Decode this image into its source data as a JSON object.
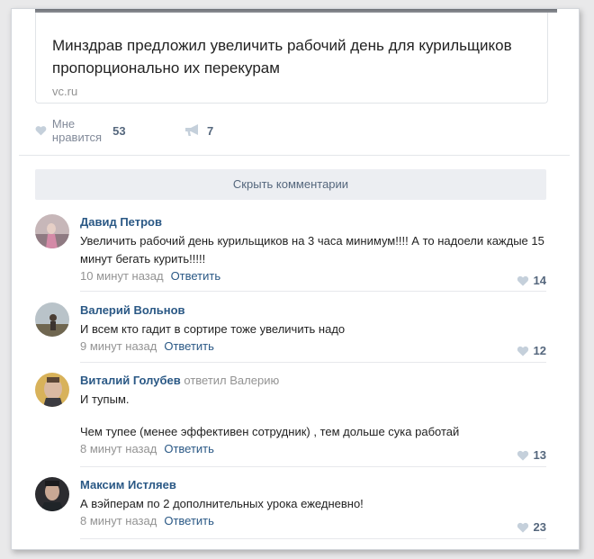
{
  "post": {
    "link_title": "Минздрав предложил увеличить рабочий день для курильщиков пропорционально их перекурам",
    "link_domain": "vc.ru",
    "like_label": "Мне нравится",
    "like_count": "53",
    "share_count": "7"
  },
  "hide_comments_label": "Скрыть комментарии",
  "comments": [
    {
      "author": "Давид Петров",
      "text": "Увеличить рабочий день курильщиков на 3 часа минимум!!!! А то надоели каждые 15 минут бегать курить!!!!!",
      "time": "10 минут назад",
      "reply_label": "Ответить",
      "likes": "14"
    },
    {
      "author": "Валерий Вольнов",
      "text": "И всем кто гадит в сортире тоже увеличить надо",
      "time": "9 минут назад",
      "reply_label": "Ответить",
      "likes": "12"
    },
    {
      "author": "Виталий Голубев",
      "reply_to": "ответил Валерию",
      "text_line1": "И тупым.",
      "text_line2": "Чем тупее (менее эффективен сотрудник) , тем дольше сука работай",
      "time": "8 минут назад",
      "reply_label": "Ответить",
      "likes": "13"
    },
    {
      "author": "Максим Истляев",
      "text": "А вэйперам по 2 дополнительных урока ежедневно!",
      "time": "8 минут назад",
      "reply_label": "Ответить",
      "likes": "23"
    }
  ],
  "icons": {
    "like": "heart-icon",
    "share": "megaphone-icon"
  },
  "colors": {
    "link": "#2a5885",
    "muted": "#939393",
    "button_bg": "#eceef2"
  }
}
